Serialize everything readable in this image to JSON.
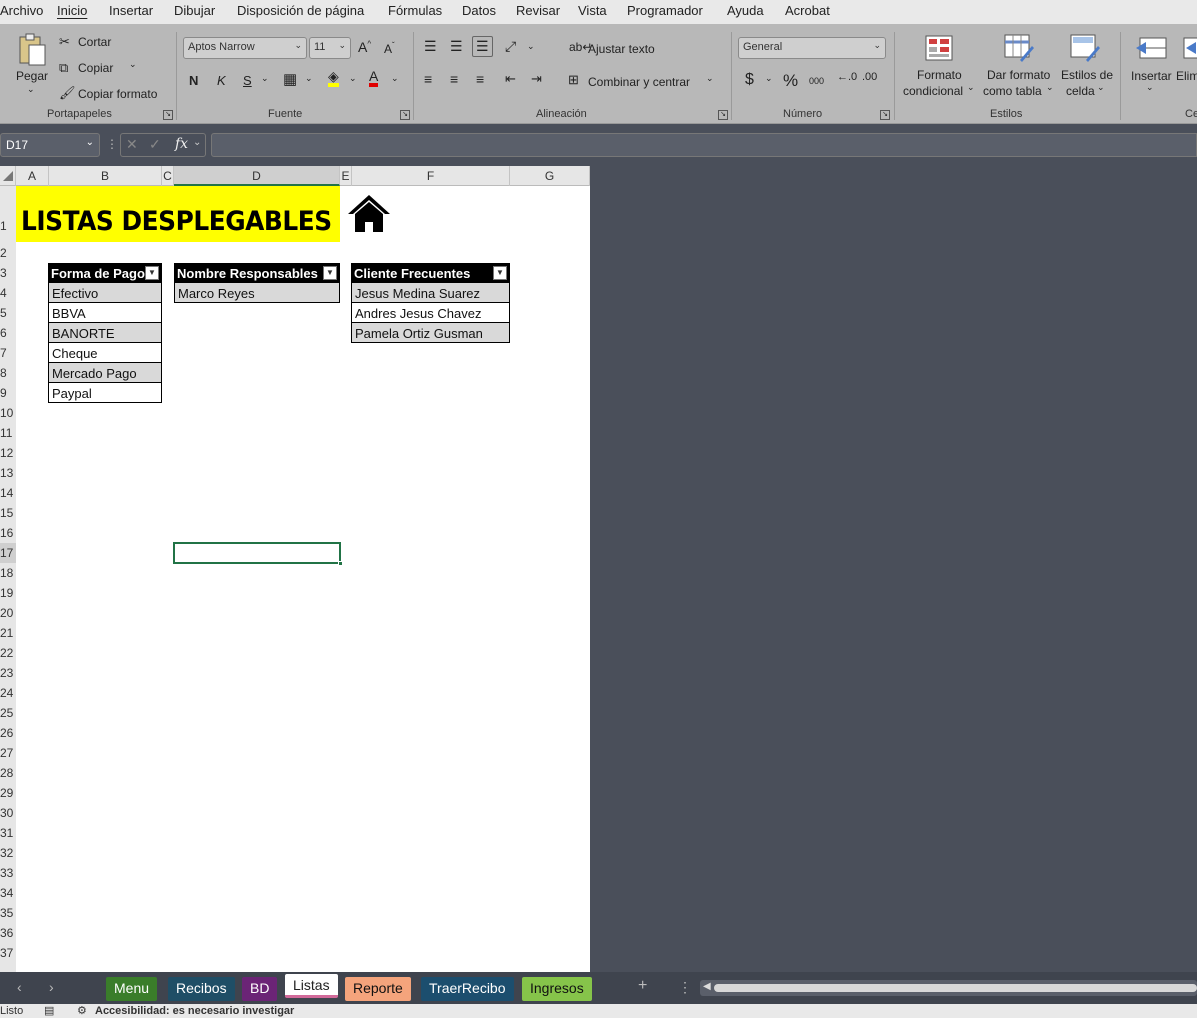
{
  "menu": {
    "items": [
      "Archivo",
      "Inicio",
      "Insertar",
      "Dibujar",
      "Disposición de página",
      "Fórmulas",
      "Datos",
      "Revisar",
      "Vista",
      "Programador",
      "Ayuda",
      "Acrobat"
    ],
    "active": "Inicio"
  },
  "ribbon": {
    "clipboard": {
      "paste": "Pegar",
      "cut": "Cortar",
      "copy": "Copiar",
      "format_painter": "Copiar formato",
      "group": "Portapapeles"
    },
    "font": {
      "family": "Aptos Narrow",
      "size": "11",
      "bold": "N",
      "italic": "K",
      "underline": "S",
      "group": "Fuente"
    },
    "alignment": {
      "wrap": "Ajustar texto",
      "merge": "Combinar y centrar",
      "group": "Alineación"
    },
    "number": {
      "format": "General",
      "currency": "$",
      "percent": "%",
      "thousands": "000",
      "group": "Número"
    },
    "styles": {
      "conditional_1": "Formato",
      "conditional_2": "condicional",
      "table_1": "Dar formato",
      "table_2": "como tabla",
      "cell_1": "Estilos de",
      "cell_2": "celda",
      "group": "Estilos"
    },
    "cells": {
      "insert": "Insertar",
      "delete": "Elim",
      "group": "Ce"
    }
  },
  "formula_bar": {
    "name_box": "D17",
    "fx": "fx",
    "formula": ""
  },
  "columns": [
    "A",
    "B",
    "C",
    "D",
    "E",
    "F",
    "G"
  ],
  "selected_column": "D",
  "rows": [
    "1",
    "2",
    "3",
    "4",
    "5",
    "6",
    "7",
    "8",
    "9",
    "10",
    "11",
    "12",
    "13",
    "14",
    "15",
    "16",
    "17",
    "18",
    "19",
    "20",
    "21",
    "22",
    "23",
    "24",
    "25",
    "26",
    "27",
    "28",
    "29",
    "30",
    "31",
    "32",
    "33",
    "34",
    "35",
    "36",
    "37"
  ],
  "selected_row": "17",
  "sheet": {
    "title": "LISTAS DESPLEGABLES",
    "home_icon": "home-icon",
    "title_color": "#ffff00"
  },
  "tables": {
    "pago": {
      "header": "Forma de Pago",
      "rows": [
        "Efectivo",
        "BBVA",
        "BANORTE",
        "Cheque",
        "Mercado Pago",
        "Paypal"
      ]
    },
    "responsables": {
      "header": "Nombre Responsables",
      "rows": [
        "Marco Reyes"
      ]
    },
    "clientes": {
      "header": "Cliente Frecuentes",
      "rows": [
        "Jesus Medina Suarez",
        "Andres Jesus Chavez",
        "Pamela Ortiz Gusman"
      ]
    }
  },
  "tabs": [
    {
      "label": "Menu",
      "color": "#3a7d2a"
    },
    {
      "label": "Recibos",
      "color": "#1f4e66"
    },
    {
      "label": "BD",
      "color": "#6b2476"
    },
    {
      "label": "Listas",
      "color": "#ffffff"
    },
    {
      "label": "Reporte",
      "color": "#f4a47c"
    },
    {
      "label": "TraerRecibo",
      "color": "#1c4e6e"
    },
    {
      "label": "Ingresos",
      "color": "#86c44a"
    }
  ],
  "active_tab": "Listas",
  "status": {
    "ready": "Listo",
    "accessibility": "Accesibilidad: es necesario investigar"
  }
}
